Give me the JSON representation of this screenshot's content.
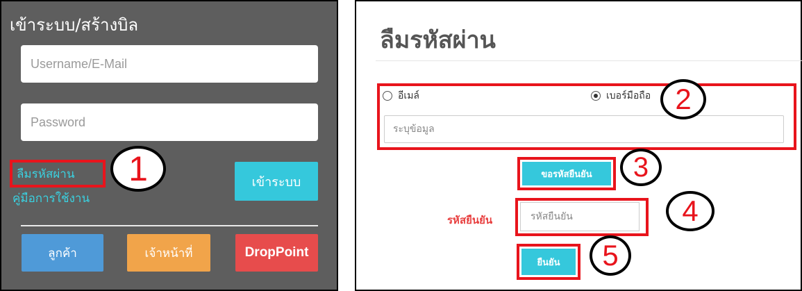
{
  "login_panel": {
    "title": "เข้าระบบ/สร้างบิล",
    "username_placeholder": "Username/E-Mail",
    "password_placeholder": "Password",
    "forgot_password": "ลืมรหัสผ่าน",
    "user_manual": "คู่มือการใช้งาน",
    "login_button": "เข้าระบบ",
    "role_buttons": [
      "ลูกค้า",
      "เจ้าหน้าที่",
      "DropPoint"
    ]
  },
  "forgot_panel": {
    "title": "ลืมรหัสผ่าน",
    "option_email": "อีเมล์",
    "option_phone": "เบอร์มือถือ",
    "selected_option": "phone",
    "info_placeholder": "ระบุข้อมูล",
    "request_otp_button": "ขอรหัสยืนยัน",
    "verify_label": "รหัสยืนยัน",
    "verify_placeholder": "รหัสยืนยัน",
    "confirm_button": "ยืนยัน"
  },
  "step_markers": [
    "1",
    "2",
    "3",
    "4",
    "5"
  ],
  "colors": {
    "panel_dark": "#5e5e5e",
    "accent_cyan": "#35c8dc",
    "link_cyan": "#3ad1e0",
    "highlight_red": "#e8141c",
    "customer_blue": "#4f9ad8",
    "staff_orange": "#f1a44a",
    "droppoint_red": "#e74c4c"
  }
}
